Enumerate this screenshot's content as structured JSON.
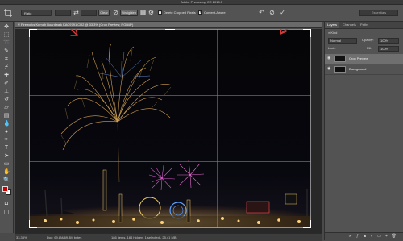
{
  "app": {
    "title": "Adobe Photoshop CC 2015.5"
  },
  "options_bar": {
    "ratio_select": "Ratio",
    "clear_label": "Clear",
    "straighten_label": "Straighten",
    "delete_cropped_label": "Delete Cropped Pixels",
    "delete_cropped_checked": true,
    "content_aware_label": "Content-Aware",
    "content_aware_checked": true,
    "workspace_label": "Essentials"
  },
  "document": {
    "tab_title": "© Fireworks Kemah Boardwalk KAC9791.CR2 @ 33.3% (Crop Preview, RGB/8*)"
  },
  "status_bar": {
    "zoom": "33.33%",
    "doc_info": "Doc: 69.8M/69.8M bytes",
    "bottom_info": "186 items, 184 hidden, 1 selected - 25.41 MB"
  },
  "layers_panel": {
    "tabs": [
      "Layers",
      "Channels",
      "Paths"
    ],
    "active_tab": "Layers",
    "kind_label": "Kind",
    "blend_mode": "Normal",
    "opacity_label": "Opacity:",
    "opacity_value": "100%",
    "lock_label": "Lock:",
    "fill_label": "Fill:",
    "fill_value": "100%",
    "layers": [
      {
        "name": "Crop Preview",
        "selected": true
      },
      {
        "name": "Background",
        "selected": false
      }
    ]
  },
  "colors": {
    "foreground": "#cc0000",
    "background": "#ffffff",
    "annotation": "#d63a3a"
  },
  "icons": {
    "crop_tool": "crop-icon",
    "swap": "swap-arrows-icon",
    "grid_overlay": "grid-icon",
    "settings": "gear-icon",
    "reset": "undo-icon",
    "cancel": "cancel-icon",
    "commit": "checkmark-icon"
  }
}
